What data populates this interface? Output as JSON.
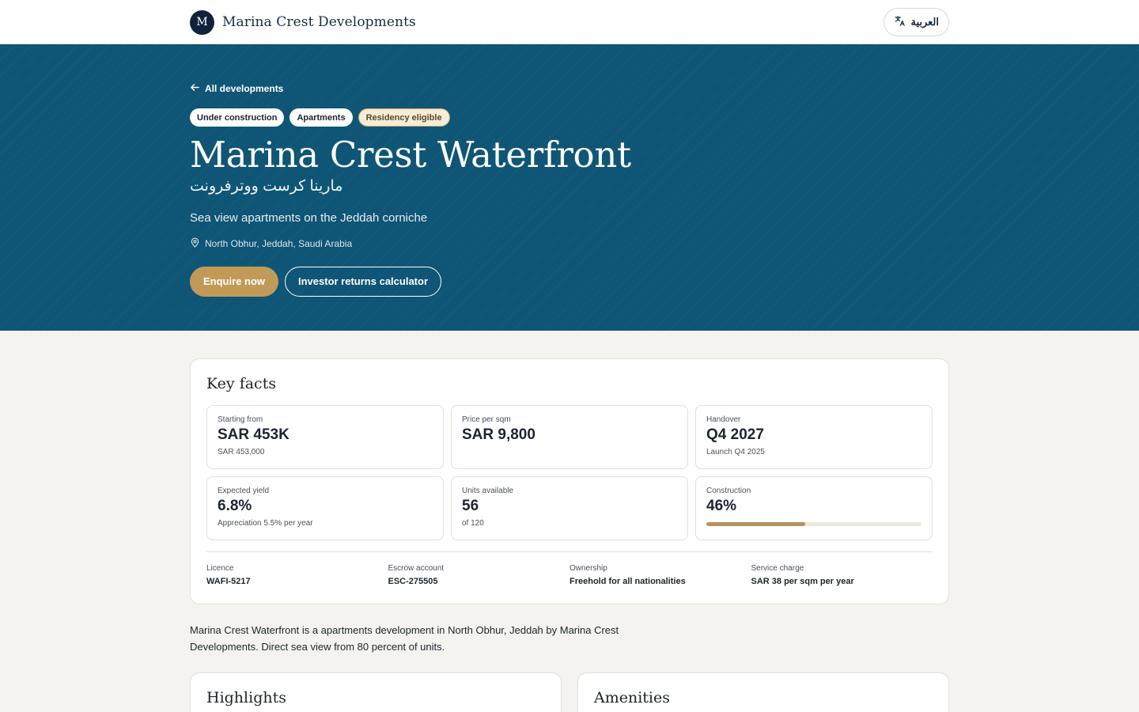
{
  "header": {
    "logo_letter": "M",
    "brand": "Marina Crest Developments",
    "language_button": "العربية",
    "language_icon": "translate-icon"
  },
  "hero": {
    "back_link": "All developments",
    "badges": [
      "Under construction",
      "Apartments",
      "Residency eligible"
    ],
    "title": "Marina Crest Waterfront",
    "title_arabic": "مارينا كرست ووترفرونت",
    "subtitle": "Sea view apartments on the Jeddah corniche",
    "location": "North Obhur, Jeddah, Saudi Arabia",
    "primary_button": "Enquire now",
    "secondary_button": "Investor returns calculator"
  },
  "key_facts": {
    "title": "Key facts",
    "items": [
      {
        "label": "Starting from",
        "value": "SAR 453K",
        "note": "SAR 453,000"
      },
      {
        "label": "Price per sqm",
        "value": "SAR 9,800",
        "note": ""
      },
      {
        "label": "Handover",
        "value": "Q4 2027",
        "note": "Launch Q4 2025"
      },
      {
        "label": "Expected yield",
        "value": "6.8%",
        "note": "Appreciation 5.5% per year"
      },
      {
        "label": "Units available",
        "value": "56",
        "note": "of 120"
      },
      {
        "label": "Construction",
        "value": "46%",
        "progress": 0.46
      }
    ],
    "meta": [
      {
        "label": "Licence",
        "value": "WAFI-5217"
      },
      {
        "label": "Escrow account",
        "value": "ESC-275505"
      },
      {
        "label": "Ownership",
        "value": "Freehold for all nationalities"
      },
      {
        "label": "Service charge",
        "value": "SAR 38 per sqm per year"
      }
    ]
  },
  "description": "Marina Crest Waterfront is a apartments development in North Obhur, Jeddah by Marina Crest Developments. Direct sea view from 80 percent of units.",
  "sections": {
    "highlights_title": "Highlights",
    "amenities_title": "Amenities"
  },
  "colors": {
    "hero_bg": "#0f5575",
    "accent_gold": "#c29a58",
    "logo_bg": "#12223d",
    "page_bg": "#f4f3ef"
  }
}
